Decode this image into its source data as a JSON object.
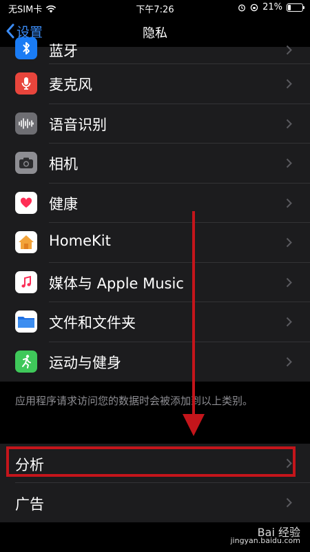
{
  "status": {
    "carrier": "无SIM卡",
    "time": "下午7:26",
    "battery": "21%"
  },
  "nav": {
    "back_label": "设置",
    "title": "隐私"
  },
  "items": [
    {
      "label": "蓝牙",
      "icon": "bluetooth-icon",
      "color": "#1a7cf5"
    },
    {
      "label": "麦克风",
      "icon": "microphone-icon",
      "color": "#e8453c"
    },
    {
      "label": "语音识别",
      "icon": "waveform-icon",
      "color": "#6e6e73"
    },
    {
      "label": "相机",
      "icon": "camera-icon",
      "color": "#8e8e93"
    },
    {
      "label": "健康",
      "icon": "heart-icon",
      "color": "#ffffff"
    },
    {
      "label": "HomeKit",
      "icon": "home-icon",
      "color": "#f2a33a"
    },
    {
      "label": "媒体与 Apple Music",
      "icon": "music-icon",
      "color": "#ffffff"
    },
    {
      "label": "文件和文件夹",
      "icon": "folder-icon",
      "color": "#1e6fe3"
    },
    {
      "label": "运动与健身",
      "icon": "fitness-icon",
      "color": "#3fc85a"
    }
  ],
  "note": "应用程序请求访问您的数据时会被添加到以上类别。",
  "group2": [
    {
      "label": "分析"
    },
    {
      "label": "广告"
    }
  ],
  "watermark": {
    "line1": "Bai 经验",
    "line2": "jingyan.baidu.com"
  },
  "colors": {
    "accent": "#3b8cf6",
    "annotation": "#c4151b",
    "cell": "#1c1c1e"
  }
}
